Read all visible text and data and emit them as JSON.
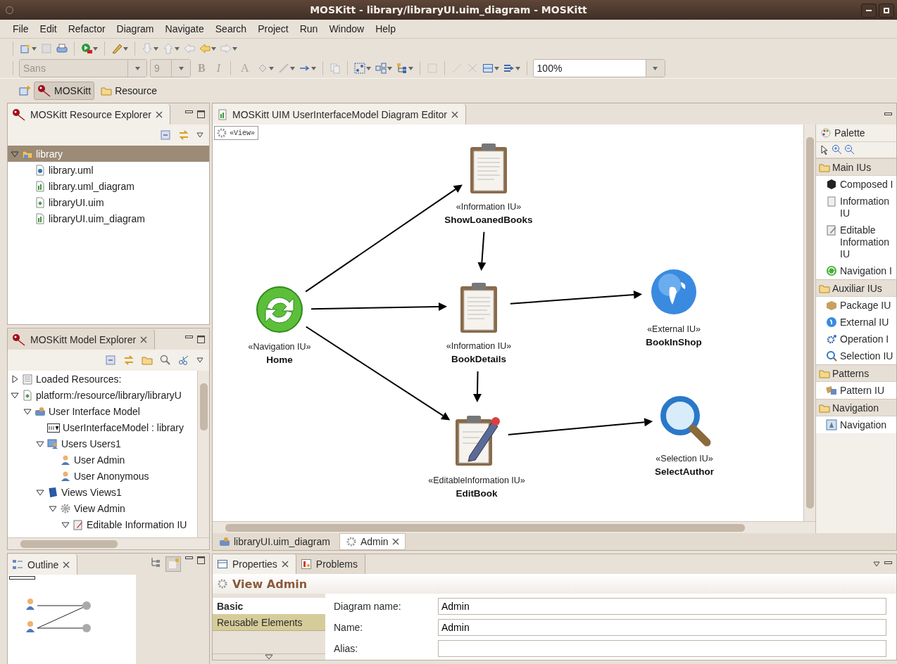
{
  "window": {
    "title": "MOSKitt - library/libraryUI.uim_diagram - MOSKitt"
  },
  "menu": [
    "File",
    "Edit",
    "Refactor",
    "Diagram",
    "Navigate",
    "Search",
    "Project",
    "Run",
    "Window",
    "Help"
  ],
  "toolbar": {
    "font": "Sans",
    "size": "9",
    "bold": "B",
    "italic": "I",
    "font_color": "A",
    "zoom": "100%"
  },
  "perspectives": [
    {
      "label": "MOSKitt",
      "selected": true
    },
    {
      "label": "Resource",
      "selected": false
    }
  ],
  "resource_explorer": {
    "title": "MOSKitt Resource Explorer",
    "tree": [
      {
        "label": "library",
        "kind": "folder",
        "expanded": true,
        "selected": true,
        "children": [
          {
            "label": "library.uml",
            "kind": "uml",
            "selected": false
          },
          {
            "label": "library.uml_diagram",
            "kind": "diagram",
            "selected": false
          },
          {
            "label": "libraryUI.uim",
            "kind": "uim",
            "selected": false
          },
          {
            "label": "libraryUI.uim_diagram",
            "kind": "diagram",
            "selected": false
          }
        ]
      }
    ]
  },
  "model_explorer": {
    "title": "MOSKitt Model Explorer",
    "tree": [
      {
        "label": "Loaded Resources:",
        "kind": "resources",
        "expanded": false,
        "selected": false
      },
      {
        "label": "platform:/resource/library/libraryU",
        "kind": "uim",
        "expanded": true,
        "selected": false,
        "children": [
          {
            "label": "User Interface Model",
            "kind": "model",
            "expanded": true,
            "selected": false,
            "children": [
              {
                "label": "UserInterfaceModel : library",
                "kind": "tag",
                "selected": false
              },
              {
                "label": "Users Users1",
                "kind": "users",
                "expanded": true,
                "selected": false,
                "children": [
                  {
                    "label": "User Admin",
                    "kind": "user",
                    "selected": false
                  },
                  {
                    "label": "User Anonymous",
                    "kind": "user",
                    "selected": false
                  }
                ]
              },
              {
                "label": "Views Views1",
                "kind": "views",
                "expanded": true,
                "selected": false,
                "children": [
                  {
                    "label": "View Admin",
                    "kind": "view",
                    "expanded": true,
                    "selected": false,
                    "children": [
                      {
                        "label": "Editable Information IU",
                        "kind": "editable",
                        "expanded": true,
                        "selected": false
                      }
                    ]
                  }
                ]
              }
            ]
          }
        ]
      }
    ]
  },
  "outline": {
    "title": "Outline"
  },
  "editor": {
    "title": "MOSKitt UIM UserInterfaceModel Diagram Editor",
    "frame_label": "«View»",
    "nodes": [
      {
        "kind": "information",
        "stereotype": "«Information IU»",
        "name": "ShowLoanedBooks"
      },
      {
        "kind": "navigation",
        "stereotype": "«Navigation IU»",
        "name": "Home"
      },
      {
        "kind": "information",
        "stereotype": "«Information IU»",
        "name": "BookDetails"
      },
      {
        "kind": "editable",
        "stereotype": "«EditableInformation IU»",
        "name": "EditBook"
      },
      {
        "kind": "external",
        "stereotype": "«External IU»",
        "name": "BookInShop"
      },
      {
        "kind": "selection",
        "stereotype": "«Selection IU»",
        "name": "SelectAuthor"
      }
    ],
    "bottom_tabs": [
      {
        "label": "libraryUI.uim_diagram",
        "selected": false
      },
      {
        "label": "Admin",
        "selected": true
      }
    ]
  },
  "palette": {
    "title": "Palette",
    "groups": [
      {
        "label": "Main IUs",
        "items": [
          {
            "label": "Composed I",
            "kind": "composed"
          },
          {
            "label": "Information IU",
            "kind": "information"
          },
          {
            "label": "Editable Information IU",
            "kind": "editable"
          },
          {
            "label": "Navigation I",
            "kind": "navigation"
          }
        ]
      },
      {
        "label": "Auxiliar IUs",
        "items": [
          {
            "label": "Package IU",
            "kind": "package"
          },
          {
            "label": "External IU",
            "kind": "external"
          },
          {
            "label": "Operation I",
            "kind": "operation"
          },
          {
            "label": "Selection IU",
            "kind": "selection"
          }
        ]
      },
      {
        "label": "Patterns",
        "items": [
          {
            "label": "Pattern IU",
            "kind": "pattern"
          }
        ]
      },
      {
        "label": "Navigation",
        "items": [
          {
            "label": "Navigation",
            "kind": "link"
          }
        ]
      }
    ]
  },
  "properties": {
    "tabs": [
      {
        "label": "Properties",
        "selected": true
      },
      {
        "label": "Problems",
        "selected": false
      }
    ],
    "heading": "View Admin",
    "sections": [
      {
        "label": "Basic",
        "selected": true
      },
      {
        "label": "Reusable Elements",
        "selected": false
      }
    ],
    "fields": [
      {
        "label": "Diagram name:",
        "value": "Admin"
      },
      {
        "label": "Name:",
        "value": "Admin"
      },
      {
        "label": "Alias:"
      }
    ]
  }
}
